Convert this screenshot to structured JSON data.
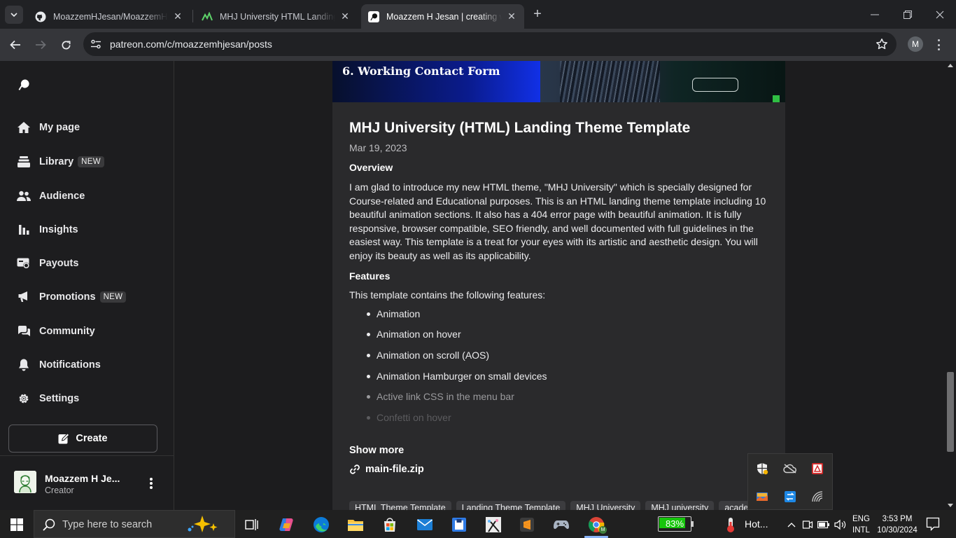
{
  "browser": {
    "tabs": [
      {
        "title": "MoazzemHJesan/MoazzemHJesan",
        "favicon": "github-icon"
      },
      {
        "title": "MHJ University HTML Landing Page",
        "favicon": "mhj-icon"
      },
      {
        "title": "Moazzem H Jesan | creating web",
        "favicon": "patreon-icon",
        "active": true
      }
    ],
    "url": "patreon.com/c/moazzemhjesan/posts",
    "profile_initial": "M"
  },
  "sidebar": {
    "items": [
      {
        "label": "My page",
        "icon": "home-icon"
      },
      {
        "label": "Library",
        "icon": "library-icon",
        "badge": "NEW"
      },
      {
        "label": "Audience",
        "icon": "audience-icon"
      },
      {
        "label": "Insights",
        "icon": "insights-icon"
      },
      {
        "label": "Payouts",
        "icon": "payouts-icon"
      },
      {
        "label": "Promotions",
        "icon": "megaphone-icon",
        "badge": "NEW"
      },
      {
        "label": "Community",
        "icon": "community-icon"
      },
      {
        "label": "Notifications",
        "icon": "bell-icon"
      },
      {
        "label": "Settings",
        "icon": "gear-icon"
      }
    ],
    "create_label": "Create",
    "user": {
      "name": "Moazzem H Je...",
      "role": "Creator"
    }
  },
  "post": {
    "banner_text": "6. Working Contact Form",
    "title": "MHJ University (HTML) Landing Theme Template",
    "date": "Mar 19, 2023",
    "overview_heading": "Overview",
    "overview": "I am glad to introduce my new HTML theme, \"MHJ University\" which is specially designed for Course-related and Educational purposes. This is an HTML landing theme template including 10 beautiful animation sections. It also has a 404 error page with beautiful animation. It is fully responsive, browser compatible, SEO friendly, and well documented with full guidelines in the easiest way. This template is a treat for your eyes with its artistic and aesthetic design. You will enjoy its beauty as well as its applicability.",
    "features_heading": "Features",
    "features_intro": "This template contains the following features:",
    "features": [
      "Animation",
      "Animation on hover",
      "Animation on scroll (AOS)",
      "Animation Hamburger on small devices",
      "Active link CSS in the menu bar",
      "Confetti on hover"
    ],
    "show_more": "Show more",
    "attachment": "main-file.zip",
    "tags": [
      "HTML Theme Template",
      "Landing Theme Template",
      "MHJ University",
      "MHJ university",
      "academy"
    ]
  },
  "taskbar": {
    "search_placeholder": "Type here to search",
    "battery": "83%",
    "battery_level": 0.83,
    "weather": "Hot...",
    "lang_1": "ENG",
    "lang_2": "INTL",
    "time": "3:53 PM",
    "date": "10/30/2024"
  },
  "colors": {
    "accent": "#ffffff",
    "battery_green": "#16c60c",
    "banner_blue": "#0a1b8d"
  }
}
